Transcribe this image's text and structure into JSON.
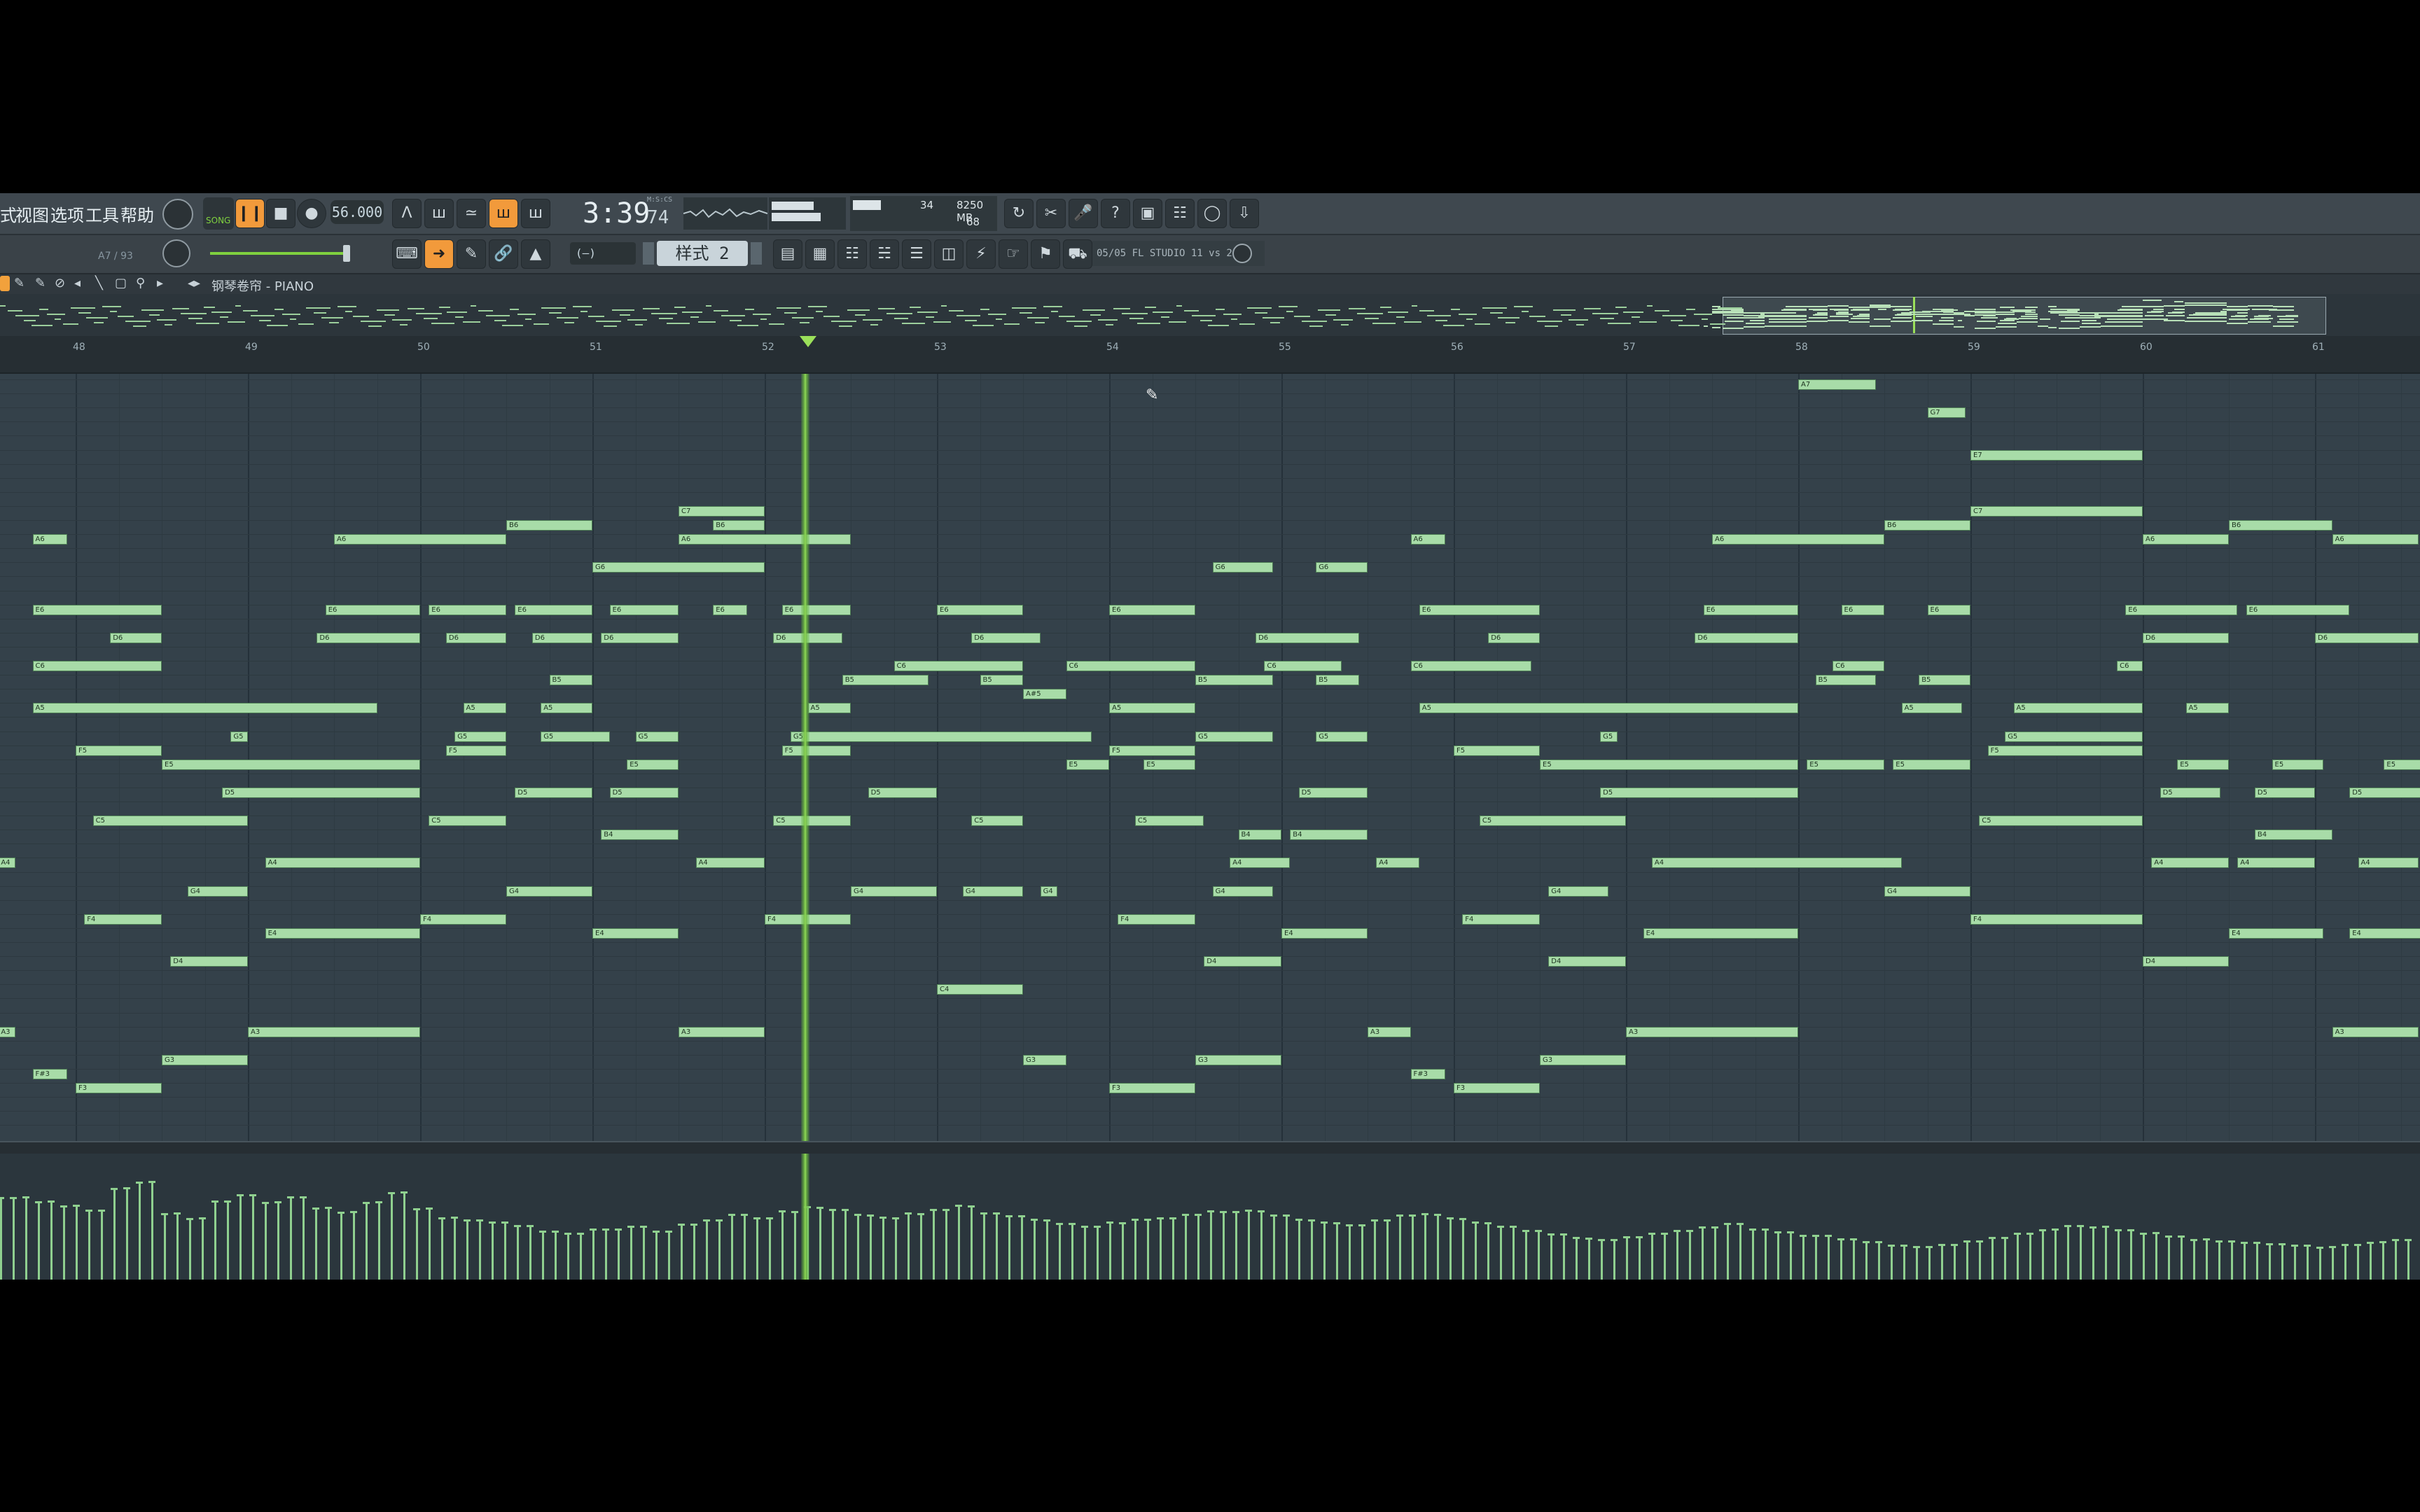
{
  "menu": {
    "items": [
      "式",
      "视图",
      "选项",
      "工具",
      "帮助"
    ]
  },
  "transport": {
    "mode_label": "SONG",
    "tempo": "56.000",
    "time_minutes_seconds": "3:39",
    "time_ticks": "74",
    "time_unit": "M:S:CS"
  },
  "monitor": {
    "cpu_value": "34",
    "memory": "8250 MB",
    "polyphony": "68"
  },
  "toolbar2": {
    "hint": "A7 / 93",
    "pattern_label": "样式 2",
    "snap_label": "(—)",
    "hint_panel": "05/05  FL STUDIO 11 vs 20?"
  },
  "piano_roll": {
    "title": "钢琴卷帘 - PIANO",
    "ruler_labels": [
      "48",
      "49",
      "50",
      "51",
      "52",
      "53",
      "54",
      "55",
      "56",
      "57",
      "58",
      "59",
      "60",
      "61"
    ]
  },
  "colors": {
    "note_fill": "#a8dca8",
    "playhead": "#8ed34f",
    "toolbar_bg": "#3f484f",
    "roll_bg": "#34414a",
    "accent_orange": "#f29a3b"
  },
  "notes": [
    {
      "pitch": "A7",
      "row": 0,
      "bar": 58.0,
      "len": 0.45
    },
    {
      "pitch": "G7",
      "row": 2,
      "bar": 58.75,
      "len": 0.22
    },
    {
      "pitch": "E7",
      "row": 5,
      "bar": 59.0,
      "len": 1.0
    },
    {
      "pitch": "C7",
      "row": 9,
      "bar": 51.5,
      "len": 0.5
    },
    {
      "pitch": "C7",
      "row": 9,
      "bar": 59.0,
      "len": 1.0
    },
    {
      "pitch": "B6",
      "row": 10,
      "bar": 50.5,
      "len": 0.5
    },
    {
      "pitch": "B6",
      "row": 10,
      "bar": 51.7,
      "len": 0.3
    },
    {
      "pitch": "B6",
      "row": 10,
      "bar": 58.5,
      "len": 0.5
    },
    {
      "pitch": "B6",
      "row": 10,
      "bar": 60.5,
      "len": 0.6
    },
    {
      "pitch": "A6",
      "row": 11,
      "bar": 47.75,
      "len": 0.2
    },
    {
      "pitch": "A6",
      "row": 11,
      "bar": 49.5,
      "len": 1.0
    },
    {
      "pitch": "A6",
      "row": 11,
      "bar": 51.5,
      "len": 1.0
    },
    {
      "pitch": "A6",
      "row": 11,
      "bar": 55.75,
      "len": 0.2
    },
    {
      "pitch": "A6",
      "row": 11,
      "bar": 57.5,
      "len": 1.0
    },
    {
      "pitch": "A6",
      "row": 11,
      "bar": 60.0,
      "len": 0.5
    },
    {
      "pitch": "A6",
      "row": 11,
      "bar": 61.1,
      "len": 0.5
    },
    {
      "pitch": "G6",
      "row": 13,
      "bar": 51.0,
      "len": 1.0
    },
    {
      "pitch": "G6",
      "row": 13,
      "bar": 54.6,
      "len": 0.35
    },
    {
      "pitch": "G6",
      "row": 13,
      "bar": 55.2,
      "len": 0.3
    },
    {
      "pitch": "E6",
      "row": 16,
      "bar": 47.75,
      "len": 0.75
    },
    {
      "pitch": "E6",
      "row": 16,
      "bar": 49.45,
      "len": 0.55
    },
    {
      "pitch": "E6",
      "row": 16,
      "bar": 50.05,
      "len": 0.45
    },
    {
      "pitch": "E6",
      "row": 16,
      "bar": 50.55,
      "len": 0.45
    },
    {
      "pitch": "E6",
      "row": 16,
      "bar": 51.1,
      "len": 0.4
    },
    {
      "pitch": "E6",
      "row": 16,
      "bar": 51.7,
      "len": 0.2
    },
    {
      "pitch": "E6",
      "row": 16,
      "bar": 52.1,
      "len": 0.4
    },
    {
      "pitch": "E6",
      "row": 16,
      "bar": 53.0,
      "len": 0.5
    },
    {
      "pitch": "E6",
      "row": 16,
      "bar": 54.0,
      "len": 0.5
    },
    {
      "pitch": "E6",
      "row": 16,
      "bar": 55.8,
      "len": 0.7
    },
    {
      "pitch": "E6",
      "row": 16,
      "bar": 57.45,
      "len": 0.55
    },
    {
      "pitch": "E6",
      "row": 16,
      "bar": 58.25,
      "len": 0.25
    },
    {
      "pitch": "E6",
      "row": 16,
      "bar": 58.75,
      "len": 0.25
    },
    {
      "pitch": "E6",
      "row": 16,
      "bar": 59.9,
      "len": 0.65
    },
    {
      "pitch": "E6",
      "row": 16,
      "bar": 60.6,
      "len": 0.6
    },
    {
      "pitch": "D6",
      "row": 18,
      "bar": 48.2,
      "len": 0.3
    },
    {
      "pitch": "D6",
      "row": 18,
      "bar": 49.4,
      "len": 0.6
    },
    {
      "pitch": "D6",
      "row": 18,
      "bar": 50.15,
      "len": 0.35
    },
    {
      "pitch": "D6",
      "row": 18,
      "bar": 50.65,
      "len": 0.35
    },
    {
      "pitch": "D6",
      "row": 18,
      "bar": 51.05,
      "len": 0.45
    },
    {
      "pitch": "D6",
      "row": 18,
      "bar": 52.05,
      "len": 0.4
    },
    {
      "pitch": "D6",
      "row": 18,
      "bar": 53.2,
      "len": 0.4
    },
    {
      "pitch": "D6",
      "row": 18,
      "bar": 54.85,
      "len": 0.6
    },
    {
      "pitch": "D6",
      "row": 18,
      "bar": 56.2,
      "len": 0.3
    },
    {
      "pitch": "D6",
      "row": 18,
      "bar": 57.4,
      "len": 0.6
    },
    {
      "pitch": "D6",
      "row": 18,
      "bar": 60.0,
      "len": 0.5
    },
    {
      "pitch": "D6",
      "row": 18,
      "bar": 61.0,
      "len": 0.6
    },
    {
      "pitch": "C6",
      "row": 20,
      "bar": 47.75,
      "len": 0.75
    },
    {
      "pitch": "C6",
      "row": 20,
      "bar": 52.75,
      "len": 0.75
    },
    {
      "pitch": "C6",
      "row": 20,
      "bar": 53.75,
      "len": 0.75
    },
    {
      "pitch": "C6",
      "row": 20,
      "bar": 54.9,
      "len": 0.45
    },
    {
      "pitch": "C6",
      "row": 20,
      "bar": 55.75,
      "len": 0.7
    },
    {
      "pitch": "C6",
      "row": 20,
      "bar": 58.2,
      "len": 0.3
    },
    {
      "pitch": "C6",
      "row": 20,
      "bar": 59.85,
      "len": 0.15
    },
    {
      "pitch": "B5",
      "row": 21,
      "bar": 50.75,
      "len": 0.25
    },
    {
      "pitch": "B5",
      "row": 21,
      "bar": 52.45,
      "len": 0.5
    },
    {
      "pitch": "B5",
      "row": 21,
      "bar": 53.25,
      "len": 0.25
    },
    {
      "pitch": "B5",
      "row": 21,
      "bar": 54.5,
      "len": 0.45
    },
    {
      "pitch": "B5",
      "row": 21,
      "bar": 55.2,
      "len": 0.25
    },
    {
      "pitch": "B5",
      "row": 21,
      "bar": 58.1,
      "len": 0.35
    },
    {
      "pitch": "B5",
      "row": 21,
      "bar": 58.7,
      "len": 0.3
    },
    {
      "pitch": "A#5",
      "row": 22,
      "bar": 53.5,
      "len": 0.25
    },
    {
      "pitch": "A5",
      "row": 23,
      "bar": 47.75,
      "len": 2.0
    },
    {
      "pitch": "A5",
      "row": 23,
      "bar": 50.25,
      "len": 0.25
    },
    {
      "pitch": "A5",
      "row": 23,
      "bar": 50.7,
      "len": 0.3
    },
    {
      "pitch": "A5",
      "row": 23,
      "bar": 52.25,
      "len": 0.25
    },
    {
      "pitch": "A5",
      "row": 23,
      "bar": 54.0,
      "len": 0.5
    },
    {
      "pitch": "A5",
      "row": 23,
      "bar": 55.8,
      "len": 2.2
    },
    {
      "pitch": "A5",
      "row": 23,
      "bar": 58.6,
      "len": 0.35
    },
    {
      "pitch": "A5",
      "row": 23,
      "bar": 59.25,
      "len": 0.75
    },
    {
      "pitch": "A5",
      "row": 23,
      "bar": 60.25,
      "len": 0.25
    },
    {
      "pitch": "G5",
      "row": 25,
      "bar": 48.9,
      "len": 0.1
    },
    {
      "pitch": "G5",
      "row": 25,
      "bar": 50.2,
      "len": 0.3
    },
    {
      "pitch": "G5",
      "row": 25,
      "bar": 50.7,
      "len": 0.4
    },
    {
      "pitch": "G5",
      "row": 25,
      "bar": 51.25,
      "len": 0.25
    },
    {
      "pitch": "G5",
      "row": 25,
      "bar": 52.15,
      "len": 1.75
    },
    {
      "pitch": "G5",
      "row": 25,
      "bar": 54.5,
      "len": 0.45
    },
    {
      "pitch": "G5",
      "row": 25,
      "bar": 55.2,
      "len": 0.3
    },
    {
      "pitch": "G5",
      "row": 25,
      "bar": 56.85,
      "len": 0.1
    },
    {
      "pitch": "G5",
      "row": 25,
      "bar": 59.2,
      "len": 0.8
    },
    {
      "pitch": "F5",
      "row": 26,
      "bar": 48.0,
      "len": 0.5
    },
    {
      "pitch": "F5",
      "row": 26,
      "bar": 50.15,
      "len": 0.35
    },
    {
      "pitch": "F5",
      "row": 26,
      "bar": 52.1,
      "len": 0.4
    },
    {
      "pitch": "F5",
      "row": 26,
      "bar": 54.0,
      "len": 0.5
    },
    {
      "pitch": "F5",
      "row": 26,
      "bar": 56.0,
      "len": 0.5
    },
    {
      "pitch": "F5",
      "row": 26,
      "bar": 59.1,
      "len": 0.9
    },
    {
      "pitch": "E5",
      "row": 27,
      "bar": 48.5,
      "len": 1.5
    },
    {
      "pitch": "E5",
      "row": 27,
      "bar": 51.2,
      "len": 0.3
    },
    {
      "pitch": "E5",
      "row": 27,
      "bar": 53.75,
      "len": 0.25
    },
    {
      "pitch": "E5",
      "row": 27,
      "bar": 54.2,
      "len": 0.3
    },
    {
      "pitch": "E5",
      "row": 27,
      "bar": 56.5,
      "len": 1.5
    },
    {
      "pitch": "E5",
      "row": 27,
      "bar": 58.05,
      "len": 0.45
    },
    {
      "pitch": "E5",
      "row": 27,
      "bar": 58.55,
      "len": 0.45
    },
    {
      "pitch": "E5",
      "row": 27,
      "bar": 60.2,
      "len": 0.3
    },
    {
      "pitch": "E5",
      "row": 27,
      "bar": 60.75,
      "len": 0.3
    },
    {
      "pitch": "E5",
      "row": 27,
      "bar": 61.4,
      "len": 0.3
    },
    {
      "pitch": "D5",
      "row": 29,
      "bar": 48.85,
      "len": 1.15
    },
    {
      "pitch": "D5",
      "row": 29,
      "bar": 50.55,
      "len": 0.45
    },
    {
      "pitch": "D5",
      "row": 29,
      "bar": 51.1,
      "len": 0.4
    },
    {
      "pitch": "D5",
      "row": 29,
      "bar": 52.6,
      "len": 0.4
    },
    {
      "pitch": "D5",
      "row": 29,
      "bar": 55.1,
      "len": 0.4
    },
    {
      "pitch": "D5",
      "row": 29,
      "bar": 56.85,
      "len": 1.15
    },
    {
      "pitch": "D5",
      "row": 29,
      "bar": 60.1,
      "len": 0.35
    },
    {
      "pitch": "D5",
      "row": 29,
      "bar": 60.65,
      "len": 0.35
    },
    {
      "pitch": "D5",
      "row": 29,
      "bar": 61.2,
      "len": 0.5
    },
    {
      "pitch": "C5",
      "row": 31,
      "bar": 48.1,
      "len": 0.9
    },
    {
      "pitch": "C5",
      "row": 31,
      "bar": 50.05,
      "len": 0.45
    },
    {
      "pitch": "C5",
      "row": 31,
      "bar": 52.05,
      "len": 0.45
    },
    {
      "pitch": "C5",
      "row": 31,
      "bar": 53.2,
      "len": 0.3
    },
    {
      "pitch": "C5",
      "row": 31,
      "bar": 54.15,
      "len": 0.4
    },
    {
      "pitch": "C5",
      "row": 31,
      "bar": 56.15,
      "len": 0.85
    },
    {
      "pitch": "C5",
      "row": 31,
      "bar": 59.05,
      "len": 0.95
    },
    {
      "pitch": "B4",
      "row": 32,
      "bar": 51.05,
      "len": 0.45
    },
    {
      "pitch": "B4",
      "row": 32,
      "bar": 54.75,
      "len": 0.25
    },
    {
      "pitch": "B4",
      "row": 32,
      "bar": 55.05,
      "len": 0.45
    },
    {
      "pitch": "B4",
      "row": 32,
      "bar": 60.65,
      "len": 0.45
    },
    {
      "pitch": "A4",
      "row": 34,
      "bar": 47.55,
      "len": 0.1
    },
    {
      "pitch": "A4",
      "row": 34,
      "bar": 49.1,
      "len": 0.9
    },
    {
      "pitch": "A4",
      "row": 34,
      "bar": 51.6,
      "len": 0.4
    },
    {
      "pitch": "A4",
      "row": 34,
      "bar": 54.7,
      "len": 0.35
    },
    {
      "pitch": "A4",
      "row": 34,
      "bar": 55.55,
      "len": 0.25
    },
    {
      "pitch": "A4",
      "row": 34,
      "bar": 57.15,
      "len": 1.45
    },
    {
      "pitch": "A4",
      "row": 34,
      "bar": 60.05,
      "len": 0.45
    },
    {
      "pitch": "A4",
      "row": 34,
      "bar": 60.55,
      "len": 0.45
    },
    {
      "pitch": "A4",
      "row": 34,
      "bar": 61.25,
      "len": 0.35
    },
    {
      "pitch": "G4",
      "row": 36,
      "bar": 48.65,
      "len": 0.35
    },
    {
      "pitch": "G4",
      "row": 36,
      "bar": 50.5,
      "len": 0.5
    },
    {
      "pitch": "G4",
      "row": 36,
      "bar": 52.5,
      "len": 0.5
    },
    {
      "pitch": "G4",
      "row": 36,
      "bar": 53.15,
      "len": 0.35
    },
    {
      "pitch": "G4",
      "row": 36,
      "bar": 53.6,
      "len": 0.1
    },
    {
      "pitch": "G4",
      "row": 36,
      "bar": 54.6,
      "len": 0.35
    },
    {
      "pitch": "G4",
      "row": 36,
      "bar": 56.55,
      "len": 0.35
    },
    {
      "pitch": "G4",
      "row": 36,
      "bar": 58.5,
      "len": 0.5
    },
    {
      "pitch": "F4",
      "row": 38,
      "bar": 48.05,
      "len": 0.45
    },
    {
      "pitch": "F4",
      "row": 38,
      "bar": 50.0,
      "len": 0.5
    },
    {
      "pitch": "F4",
      "row": 38,
      "bar": 52.0,
      "len": 0.5
    },
    {
      "pitch": "F4",
      "row": 38,
      "bar": 54.05,
      "len": 0.45
    },
    {
      "pitch": "F4",
      "row": 38,
      "bar": 56.05,
      "len": 0.45
    },
    {
      "pitch": "F4",
      "row": 38,
      "bar": 59.0,
      "len": 1.0
    },
    {
      "pitch": "E4",
      "row": 39,
      "bar": 49.1,
      "len": 0.9
    },
    {
      "pitch": "E4",
      "row": 39,
      "bar": 51.0,
      "len": 0.5
    },
    {
      "pitch": "E4",
      "row": 39,
      "bar": 55.0,
      "len": 0.5
    },
    {
      "pitch": "E4",
      "row": 39,
      "bar": 57.1,
      "len": 0.9
    },
    {
      "pitch": "E4",
      "row": 39,
      "bar": 60.5,
      "len": 0.55
    },
    {
      "pitch": "E4",
      "row": 39,
      "bar": 61.2,
      "len": 0.5
    },
    {
      "pitch": "D4",
      "row": 41,
      "bar": 48.55,
      "len": 0.45
    },
    {
      "pitch": "D4",
      "row": 41,
      "bar": 54.55,
      "len": 0.45
    },
    {
      "pitch": "D4",
      "row": 41,
      "bar": 56.55,
      "len": 0.45
    },
    {
      "pitch": "D4",
      "row": 41,
      "bar": 60.0,
      "len": 0.5
    },
    {
      "pitch": "C4",
      "row": 43,
      "bar": 53.0,
      "len": 0.5
    },
    {
      "pitch": "A3",
      "row": 46,
      "bar": 47.55,
      "len": 0.1
    },
    {
      "pitch": "A3",
      "row": 46,
      "bar": 49.0,
      "len": 1.0
    },
    {
      "pitch": "A3",
      "row": 46,
      "bar": 51.5,
      "len": 0.5
    },
    {
      "pitch": "A3",
      "row": 46,
      "bar": 55.5,
      "len": 0.25
    },
    {
      "pitch": "A3",
      "row": 46,
      "bar": 57.0,
      "len": 1.0
    },
    {
      "pitch": "A3",
      "row": 46,
      "bar": 61.1,
      "len": 0.5
    },
    {
      "pitch": "G3",
      "row": 48,
      "bar": 48.5,
      "len": 0.5
    },
    {
      "pitch": "G3",
      "row": 48,
      "bar": 53.5,
      "len": 0.25
    },
    {
      "pitch": "G3",
      "row": 48,
      "bar": 54.5,
      "len": 0.5
    },
    {
      "pitch": "G3",
      "row": 48,
      "bar": 56.5,
      "len": 0.5
    },
    {
      "pitch": "F#3",
      "row": 49,
      "bar": 47.75,
      "len": 0.2
    },
    {
      "pitch": "F#3",
      "row": 49,
      "bar": 55.75,
      "len": 0.2
    },
    {
      "pitch": "F3",
      "row": 50,
      "bar": 48.0,
      "len": 0.5
    },
    {
      "pitch": "F3",
      "row": 50,
      "bar": 54.0,
      "len": 0.5
    },
    {
      "pitch": "F3",
      "row": 50,
      "bar": 56.0,
      "len": 0.5
    }
  ],
  "velocities": [
    0.8,
    0.75,
    0.7,
    0.65,
    0.85,
    0.9,
    0.6,
    0.55,
    0.7,
    0.75,
    0.68,
    0.72,
    0.62,
    0.58,
    0.66,
    0.74,
    0.6,
    0.52,
    0.5,
    0.48,
    0.45,
    0.4,
    0.38,
    0.42,
    0.44,
    0.4,
    0.46,
    0.5,
    0.55,
    0.52,
    0.58,
    0.62,
    0.6,
    0.56,
    0.54,
    0.58,
    0.62,
    0.66,
    0.6,
    0.58,
    0.55,
    0.52,
    0.5,
    0.54,
    0.58,
    0.6,
    0.64,
    0.68,
    0.7,
    0.66,
    0.62,
    0.6,
    0.58,
    0.64,
    0.7,
    0.72,
    0.68,
    0.64,
    0.6,
    0.56,
    0.52,
    0.48,
    0.46,
    0.5,
    0.54,
    0.58,
    0.62,
    0.66,
    0.6,
    0.56,
    0.52,
    0.48,
    0.44,
    0.4,
    0.38,
    0.4,
    0.44,
    0.48,
    0.52,
    0.56,
    0.6,
    0.58,
    0.54,
    0.5,
    0.46,
    0.42,
    0.4,
    0.38,
    0.36,
    0.34,
    0.32,
    0.34,
    0.36,
    0.38
  ]
}
